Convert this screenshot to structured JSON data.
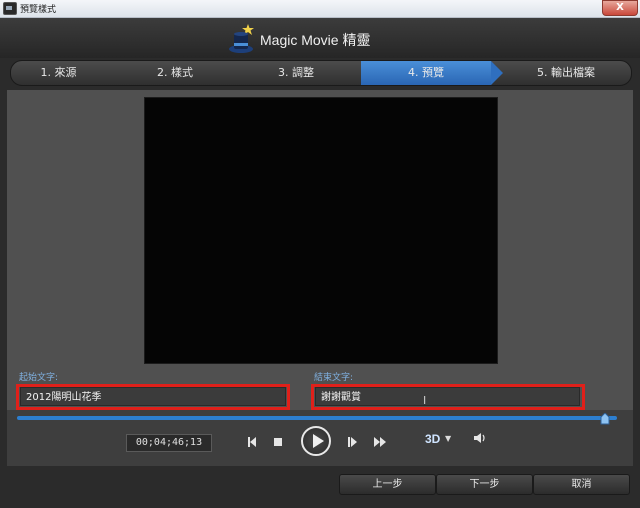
{
  "window": {
    "title": "預覽樣式",
    "close_glyph": "X"
  },
  "header": {
    "app_name": "Magic Movie 精靈",
    "logo_icon": "magic-hat-icon"
  },
  "steps": [
    {
      "label": "1. 來源",
      "active": false
    },
    {
      "label": "2. 樣式",
      "active": false
    },
    {
      "label": "3. 調整",
      "active": false
    },
    {
      "label": "4. 預覽",
      "active": true
    },
    {
      "label": "5. 輸出檔案",
      "active": false
    }
  ],
  "fields": {
    "start_label": "起始文字:",
    "start_value": "2012陽明山花季",
    "end_label": "結束文字:",
    "end_value": "謝謝觀賞"
  },
  "player": {
    "timecode": "00;04;46;13",
    "progress_fraction": 0.98,
    "three_d_label": "3D",
    "icons": [
      "prev-frame-icon",
      "stop-icon",
      "play-icon",
      "next-frame-icon",
      "fast-forward-icon",
      "volume-icon"
    ]
  },
  "footer": {
    "prev_label": "上一步",
    "next_label": "下一步",
    "cancel_label": "取消"
  },
  "colors": {
    "accent": "#2d7fd0",
    "highlight_box": "#e0201a",
    "active_step": "#2a66b4"
  }
}
